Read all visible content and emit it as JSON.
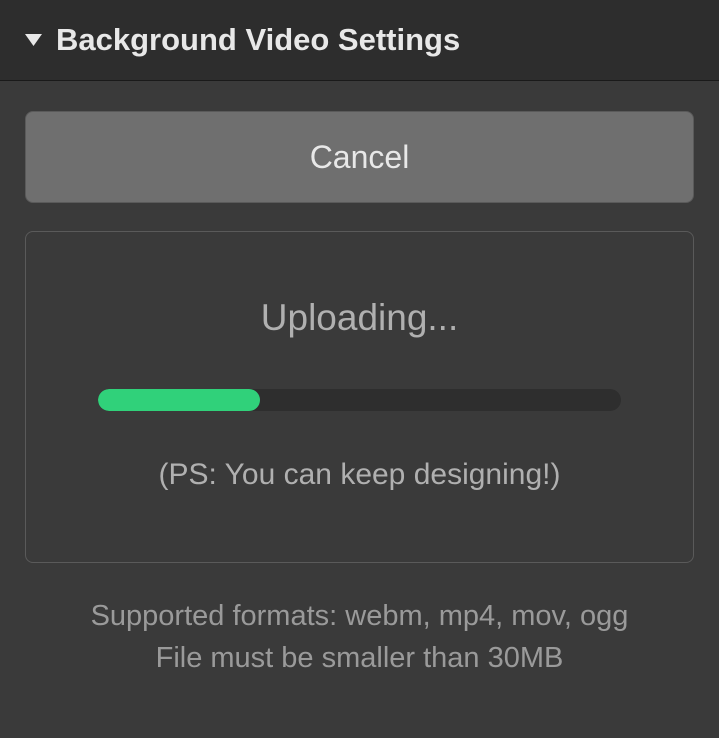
{
  "header": {
    "title": "Background Video Settings"
  },
  "cancel": {
    "label": "Cancel"
  },
  "upload": {
    "status_label": "Uploading...",
    "progress_percent": 31,
    "note": "(PS: You can keep designing!)"
  },
  "info": {
    "formats": "Supported formats: webm, mp4, mov, ogg",
    "size_limit": "File must be smaller than 30MB"
  },
  "colors": {
    "progress_fill": "#30d17a"
  }
}
